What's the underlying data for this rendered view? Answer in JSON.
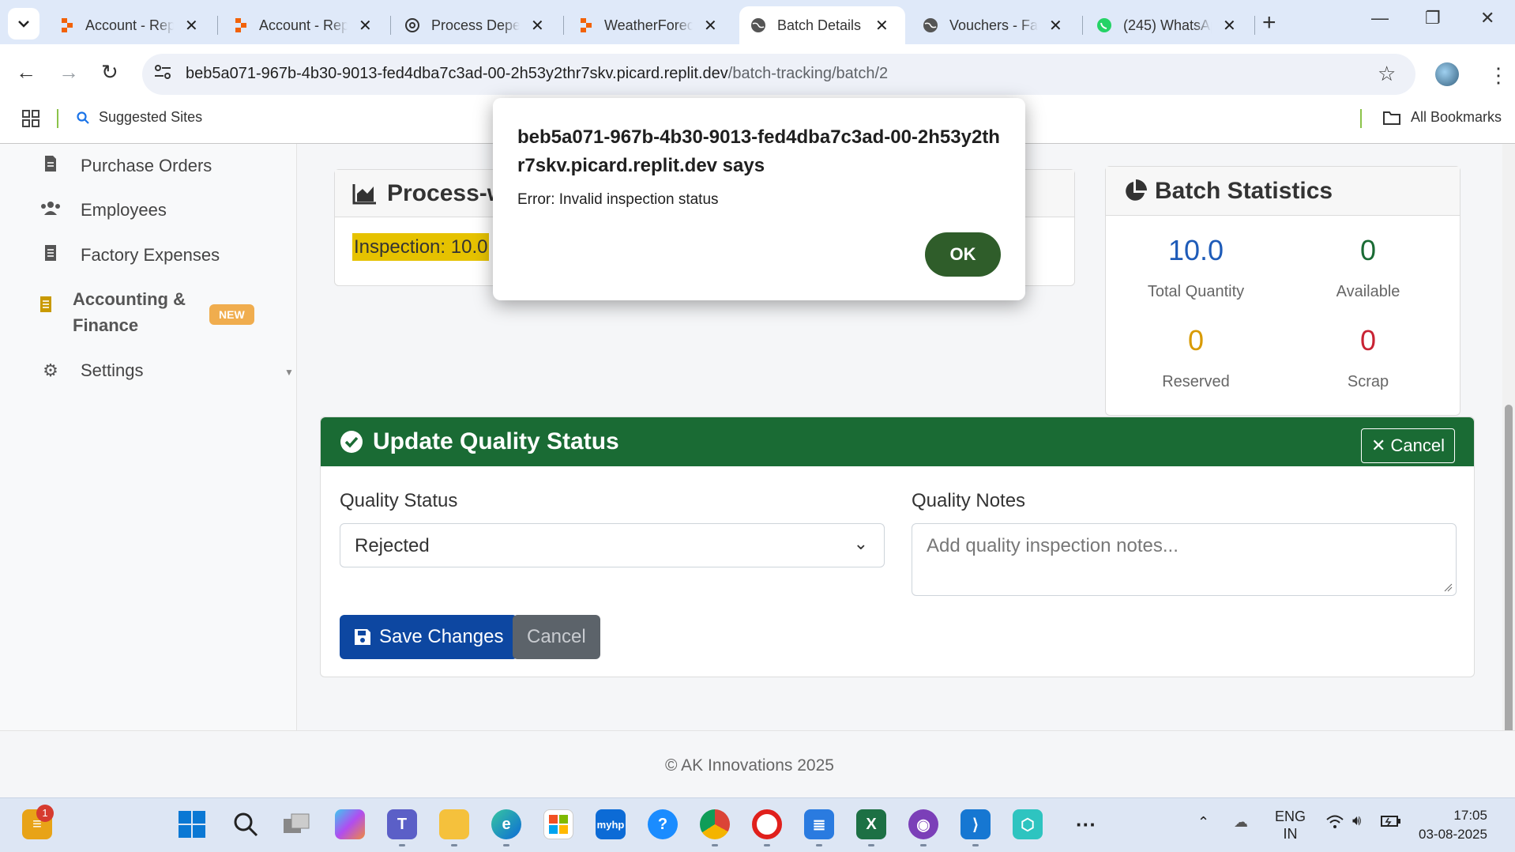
{
  "browser": {
    "tabs": [
      {
        "title": "Account - Rep",
        "icon": "replit-icon",
        "active": false
      },
      {
        "title": "Account - Rep",
        "icon": "replit-icon",
        "active": false
      },
      {
        "title": "Process Deper",
        "icon": "chatgpt-icon",
        "active": false
      },
      {
        "title": "WeatherForec",
        "icon": "replit-icon",
        "active": false
      },
      {
        "title": "Batch Details",
        "icon": "globe-icon",
        "active": true
      },
      {
        "title": "Vouchers - Fa",
        "icon": "globe-icon",
        "active": false
      },
      {
        "title": "(245) WhatsAp",
        "icon": "whatsapp-icon",
        "active": false
      }
    ],
    "url_host": "beb5a071-967b-4b30-9013-fed4dba7c3ad-00-2h53y2thr7skv.picard.replit.dev",
    "url_path": "/batch-tracking/batch/2",
    "bookmarks": {
      "suggested": "Suggested Sites",
      "all": "All Bookmarks"
    }
  },
  "sidebar": {
    "items": [
      {
        "label": "Purchase Orders",
        "icon": "document-icon"
      },
      {
        "label": "Employees",
        "icon": "users-icon"
      },
      {
        "label": "Factory Expenses",
        "icon": "receipt-icon"
      },
      {
        "label": "Accounting & Finance",
        "icon": "ledger-icon",
        "badge": "NEW"
      },
      {
        "label": "Settings",
        "icon": "gear-icon"
      }
    ]
  },
  "process_card": {
    "title": "Process-w",
    "highlight": "Inspection: 10.0"
  },
  "batch_stats": {
    "title": "Batch Statistics",
    "stats": [
      {
        "value": "10.0",
        "label": "Total Quantity",
        "color": "#1e5bb8"
      },
      {
        "value": "0",
        "label": "Available",
        "color": "#1a6b34"
      },
      {
        "value": "0",
        "label": "Reserved",
        "color": "#d89a00"
      },
      {
        "value": "0",
        "label": "Scrap",
        "color": "#c82333"
      }
    ]
  },
  "quality": {
    "title": "Update Quality Status",
    "cancel_top": "Cancel",
    "status_label": "Quality Status",
    "status_value": "Rejected",
    "notes_label": "Quality Notes",
    "notes_placeholder": "Add quality inspection notes...",
    "save": "Save Changes",
    "cancel": "Cancel"
  },
  "footer": {
    "text": "© AK Innovations 2025"
  },
  "dialog": {
    "title": "beb5a071-967b-4b30-9013-fed4dba7c3ad-00-2h53y2thr7skv.picard.replit.dev says",
    "message": "Error: Invalid inspection status",
    "ok": "OK"
  },
  "taskbar": {
    "notification_count": "1",
    "lang_top": "ENG",
    "lang_bottom": "IN",
    "time": "17:05",
    "date": "03-08-2025"
  }
}
